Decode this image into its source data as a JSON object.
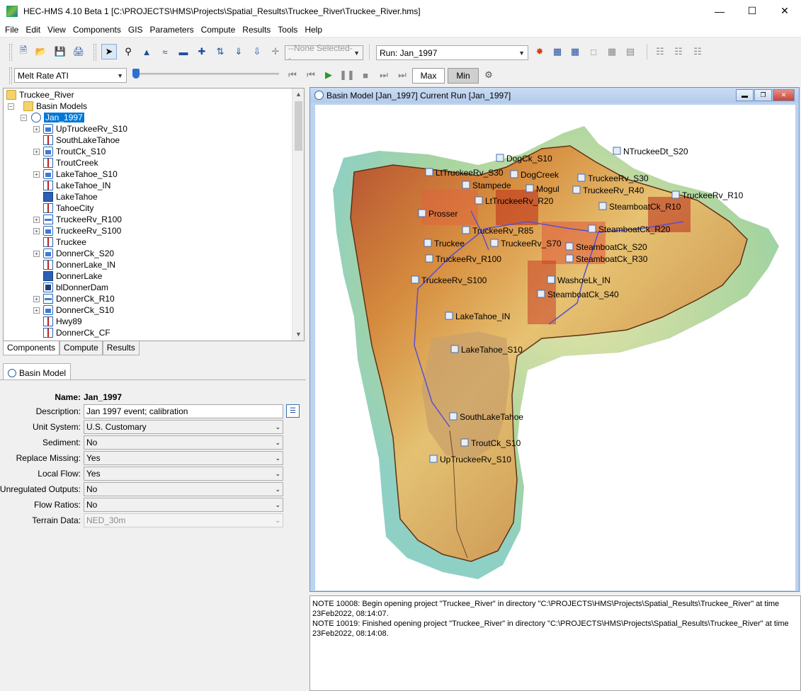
{
  "window": {
    "title": "HEC-HMS 4.10 Beta 1 [C:\\PROJECTS\\HMS\\Projects\\Spatial_Results\\Truckee_River\\Truckee_River.hms]",
    "minimize": "—",
    "maximize": "☐",
    "close": "✕"
  },
  "menu": [
    "File",
    "Edit",
    "View",
    "Components",
    "GIS",
    "Parameters",
    "Compute",
    "Results",
    "Tools",
    "Help"
  ],
  "toolbar": {
    "selection_combo": "--None Selected--",
    "run_combo": "Run: Jan_1997",
    "parameter_combo": "Melt Rate ATI",
    "max_label": "Max",
    "min_label": "Min"
  },
  "tree": {
    "root": "Truckee_River",
    "folder": "Basin Models",
    "basin": "Jan_1997",
    "items": [
      {
        "label": "UpTruckeeRv_S10",
        "kind": "sub",
        "expand": true
      },
      {
        "label": "SouthLakeTahoe",
        "kind": "junc",
        "expand": false
      },
      {
        "label": "TroutCk_S10",
        "kind": "sub",
        "expand": true
      },
      {
        "label": "TroutCreek",
        "kind": "junc",
        "expand": false
      },
      {
        "label": "LakeTahoe_S10",
        "kind": "sub",
        "expand": true
      },
      {
        "label": "LakeTahoe_IN",
        "kind": "junc",
        "expand": false
      },
      {
        "label": "LakeTahoe",
        "kind": "res",
        "expand": false
      },
      {
        "label": "TahoeCity",
        "kind": "junc",
        "expand": false
      },
      {
        "label": "TruckeeRv_R100",
        "kind": "reach",
        "expand": true
      },
      {
        "label": "TruckeeRv_S100",
        "kind": "sub",
        "expand": true
      },
      {
        "label": "Truckee",
        "kind": "junc",
        "expand": false
      },
      {
        "label": "DonnerCk_S20",
        "kind": "sub",
        "expand": true
      },
      {
        "label": "DonnerLake_IN",
        "kind": "junc",
        "expand": false
      },
      {
        "label": "DonnerLake",
        "kind": "res",
        "expand": false
      },
      {
        "label": "blDonnerDam",
        "kind": "dam",
        "expand": false
      },
      {
        "label": "DonnerCk_R10",
        "kind": "reach",
        "expand": true
      },
      {
        "label": "DonnerCk_S10",
        "kind": "sub",
        "expand": true
      },
      {
        "label": "Hwy89",
        "kind": "junc",
        "expand": false
      },
      {
        "label": "DonnerCk_CF",
        "kind": "junc",
        "expand": false
      }
    ]
  },
  "tabs": [
    "Components",
    "Compute",
    "Results"
  ],
  "properties": {
    "tab_label": "Basin Model",
    "name_label": "Name:",
    "name_value": "Jan_1997",
    "fields": [
      {
        "label": "Description:",
        "value": "Jan 1997 event; calibration",
        "type": "text"
      },
      {
        "label": "Unit System:",
        "value": "U.S. Customary",
        "type": "combo"
      },
      {
        "label": "Sediment:",
        "value": "No",
        "type": "combo"
      },
      {
        "label": "Replace Missing:",
        "value": "Yes",
        "type": "combo"
      },
      {
        "label": "Local Flow:",
        "value": "Yes",
        "type": "combo"
      },
      {
        "label": "Unregulated Outputs:",
        "value": "No",
        "type": "combo"
      },
      {
        "label": "Flow Ratios:",
        "value": "No",
        "type": "combo"
      },
      {
        "label": "Terrain Data:",
        "value": "NED_30m",
        "type": "disabled"
      }
    ]
  },
  "map": {
    "title": "Basin Model [Jan_1997] Current Run [Jan_1997]",
    "labels": [
      "DogCk_S10",
      "NTruckeeDt_S20",
      "LtTruckeeRv_S30",
      "DogCreek",
      "TruckeeRv_S30",
      "Stampede",
      "Mogul",
      "TruckeeRv_R40",
      "TruckeeRv_R10",
      "LtTruckeeRv_R20",
      "SteamboatCk_R10",
      "Prosser",
      "SteamboatCk_R20",
      "TruckeeRv_R85",
      "Truckee",
      "TruckeeRv_S70",
      "SteamboatCk_S20",
      "TruckeeRv_R100",
      "SteamboatCk_R30",
      "TruckeeRv_S100",
      "WashoeLk_IN",
      "SteamboatCk_S40",
      "LakeTahoe_IN",
      "LakeTahoe_S10",
      "SouthLakeTahoe",
      "TroutCk_S10",
      "UpTruckeeRv_S10"
    ]
  },
  "log": [
    "NOTE 10008:  Begin opening project \"Truckee_River\" in directory \"C:\\PROJECTS\\HMS\\Projects\\Spatial_Results\\Truckee_River\" at time 23Feb2022, 08:14:07.",
    "NOTE 10019:  Finished opening project \"Truckee_River\" in directory \"C:\\PROJECTS\\HMS\\Projects\\Spatial_Results\\Truckee_River\" at time 23Feb2022, 08:14:08."
  ]
}
